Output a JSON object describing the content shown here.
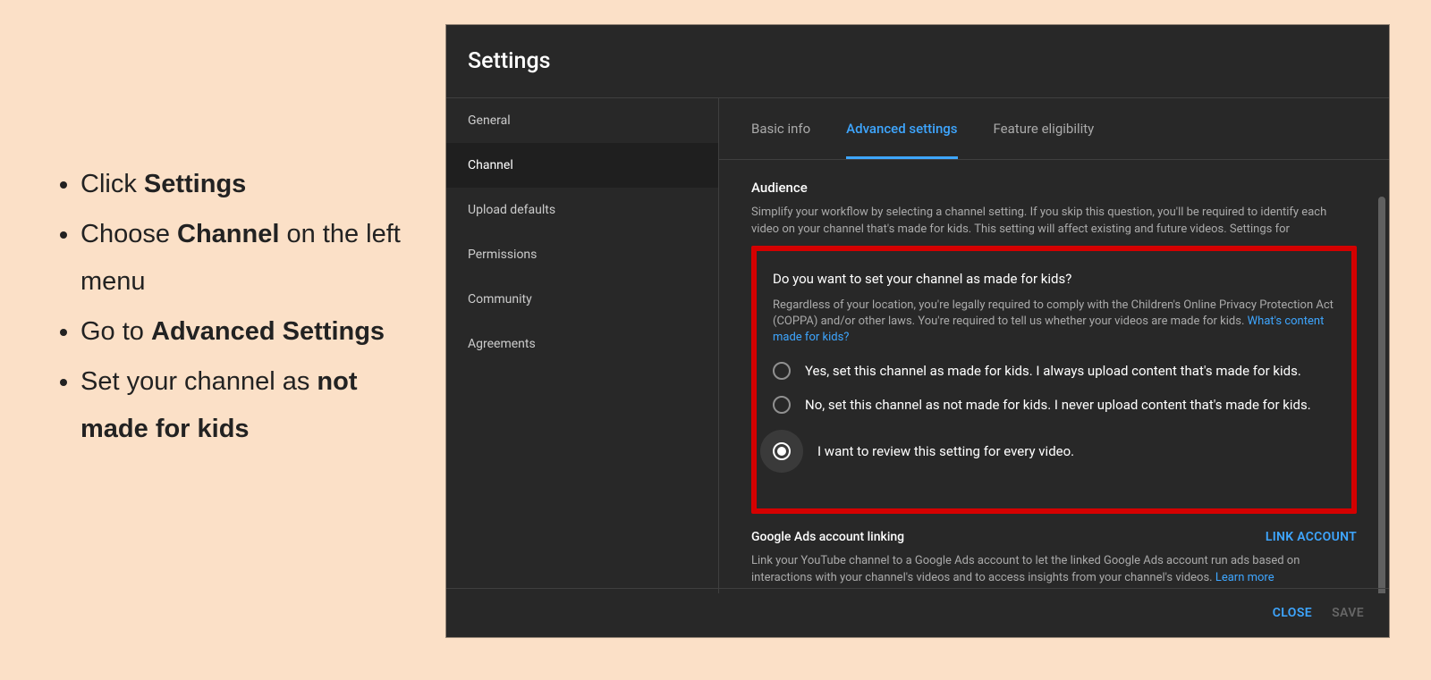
{
  "instructions": {
    "i0_a": "Click ",
    "i0_b": "Settings",
    "i1_a": "Choose ",
    "i1_b": "Channel",
    "i1_c": " on the left menu",
    "i2_a": "Go to ",
    "i2_b": "Advanced Settings",
    "i3_a": "Set your channel as ",
    "i3_b": "not made for kids"
  },
  "dialog": {
    "title": "Settings",
    "sidebar": [
      "General",
      "Channel",
      "Upload defaults",
      "Permissions",
      "Community",
      "Agreements"
    ],
    "sidebar_active": 1,
    "tabs": [
      "Basic info",
      "Advanced settings",
      "Feature eligibility"
    ],
    "tabs_active": 1,
    "audience": {
      "heading": "Audience",
      "desc": "Simplify your workflow by selecting a channel setting. If you skip this question, you'll be required to identify each video on your channel that's made for kids. This setting will affect existing and future videos. Settings for",
      "question": "Do you want to set your channel as made for kids?",
      "legal_a": "Regardless of your location, you're legally required to comply with the Children's Online Privacy Protection Act (COPPA) and/or other laws. You're required to tell us whether your videos are made for kids. ",
      "legal_link": "What's content made for kids?",
      "options": [
        "Yes, set this channel as made for kids. I always upload content that's made for kids.",
        "No, set this channel as not made for kids. I never upload content that's made for kids.",
        "I want to review this setting for every video."
      ],
      "selected": 2
    },
    "ads": {
      "title": "Google Ads account linking",
      "button": "LINK ACCOUNT",
      "desc_a": "Link your YouTube channel to a Google Ads account to let the linked Google Ads account run ads based on interactions with your channel's videos and to access insights from your channel's videos. ",
      "desc_link": "Learn more"
    },
    "footer": {
      "close": "CLOSE",
      "save": "SAVE"
    }
  }
}
